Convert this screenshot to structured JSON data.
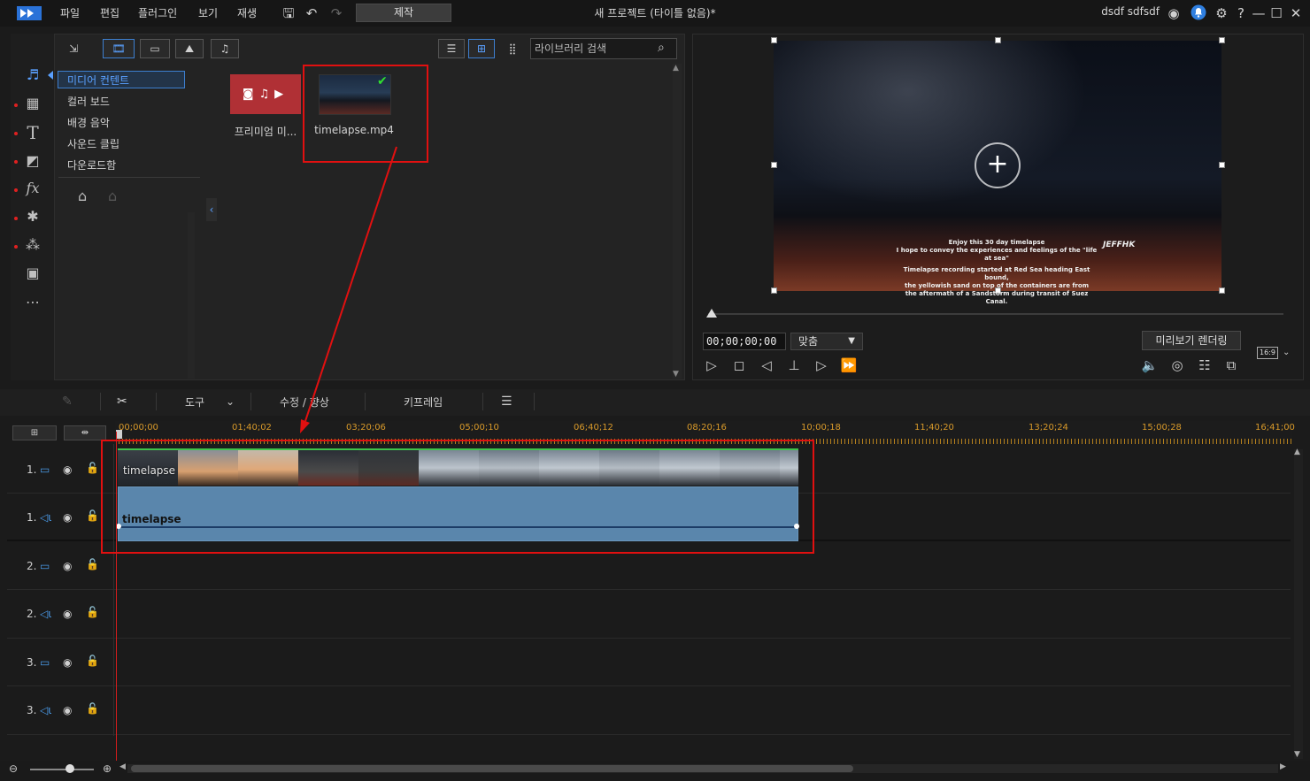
{
  "titlebar": {
    "menus": [
      "파일",
      "편집",
      "플러그인",
      "보기",
      "재생"
    ],
    "produce_label": "제작",
    "window_title": "새 프로젝트 (타이틀 없음)*",
    "username": "dsdf sdfsdf"
  },
  "library": {
    "search_placeholder": "라이브러리 검색",
    "tree": [
      "미디어 컨텐트",
      "컬러 보드",
      "배경 음악",
      "사운드 클립",
      "다운로드함"
    ],
    "items": [
      {
        "label": "프리미엄 미...",
        "icon": "premium-media-icon"
      },
      {
        "label": "timelapse.mp4",
        "icon": "video-thumbnail",
        "checked": true
      }
    ]
  },
  "preview": {
    "overlay_lines": [
      "Enjoy this 30 day timelapse",
      "I hope to convey the experiences and feelings of the \"life at sea\"",
      "Timelapse recording started at Red Sea heading East bound,",
      "the yellowish sand on top of the containers are from",
      "the aftermath of a Sandstorm during transit of Suez Canal."
    ],
    "overlay_logo": "JEFFHK",
    "timecode": "00;00;00;00",
    "fit_label": "맞춤",
    "render_label": "미리보기 렌더링",
    "aspect_label": "16:9"
  },
  "edit_toolbar": {
    "tools_label": "도구",
    "fix_label": "수정 / 향상",
    "keyframe_label": "키프레임"
  },
  "timeline": {
    "ticks": [
      "00;00;00",
      "01;40;02",
      "03;20;06",
      "05;00;10",
      "06;40;12",
      "08;20;16",
      "10;00;18",
      "11;40;20",
      "13;20;24",
      "15;00;28",
      "16;41;00"
    ],
    "tracks": [
      {
        "num": "1.",
        "type": "video"
      },
      {
        "num": "1.",
        "type": "audio"
      },
      {
        "num": "2.",
        "type": "video"
      },
      {
        "num": "2.",
        "type": "audio"
      },
      {
        "num": "3.",
        "type": "video"
      },
      {
        "num": "3.",
        "type": "audio"
      }
    ],
    "video_clip_label": "timelapse",
    "audio_clip_label": "timelapse"
  },
  "colors": {
    "accent": "#3d7fd0",
    "highlight": "#e11010",
    "clip_audio": "#5a86ac",
    "clip_video_border": "#3fc24b",
    "ruler_text": "#d99a2a"
  }
}
